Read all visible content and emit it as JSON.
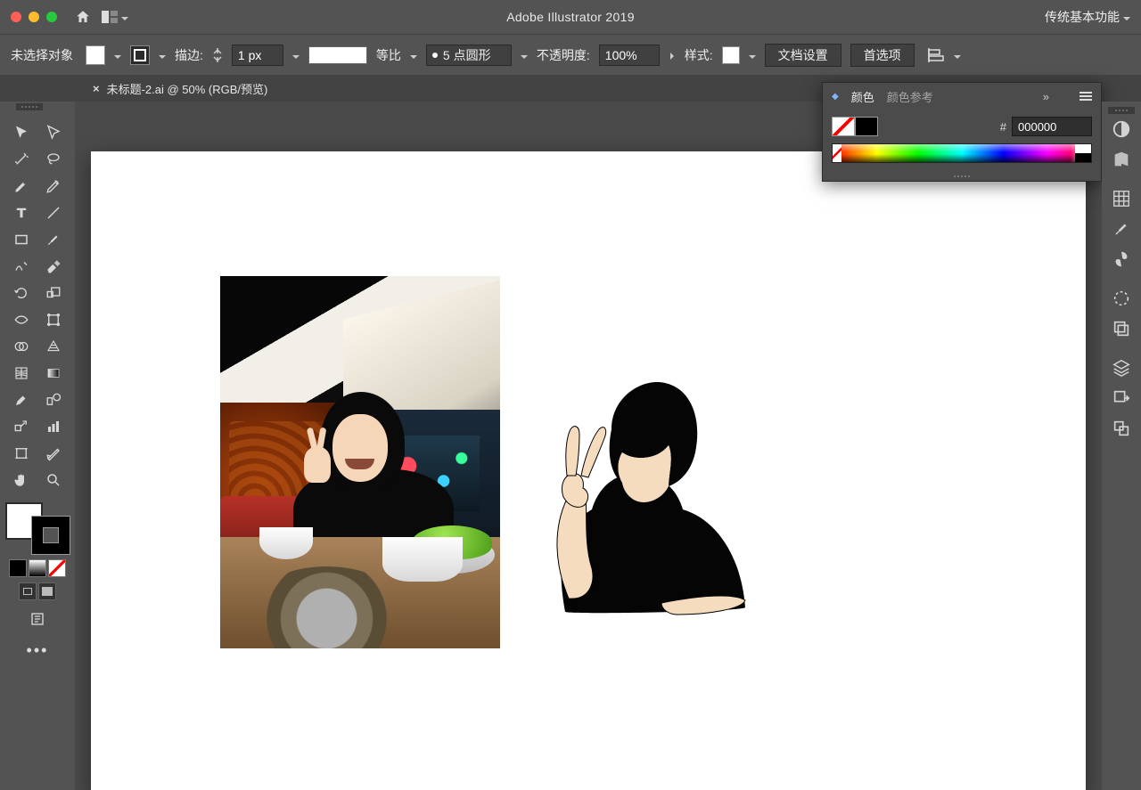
{
  "app": {
    "title": "Adobe Illustrator 2019",
    "workspace_label": "传统基本功能"
  },
  "controlbar": {
    "selection_status": "未选择对象",
    "stroke_label": "描边:",
    "stroke_width": "1 px",
    "profile_label": "等比",
    "cap_label": "5 点圆形",
    "opacity_label": "不透明度:",
    "opacity_value": "100%",
    "style_label": "样式:",
    "doc_setup_btn": "文档设置",
    "prefs_btn": "首选项"
  },
  "document": {
    "tab_title": "未标题-2.ai @ 50% (RGB/预览)"
  },
  "color_panel": {
    "tab_color": "颜色",
    "tab_guide": "颜色参考",
    "hex_label": "#",
    "hex_value": "000000"
  },
  "colors": {
    "ui_bg": "#535353",
    "canvas_bg": "#4a4a4a"
  }
}
